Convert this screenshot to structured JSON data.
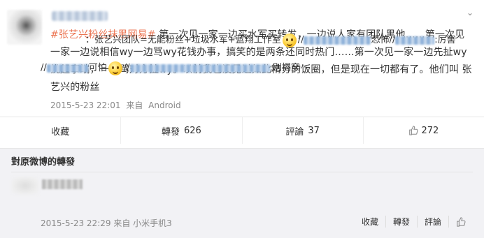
{
  "post": {
    "tag": "#张艺兴粉丝抹黑网易#",
    "text": " 第一次见一家一边买水军买转发，一边说人家有团队黑他……第一次见一家一边说相信wy一边骂wy花钱办事，搞笑的是两条还同时热门……第一次见一家一边先扯wy挑起事端，一边骂对方扯wy。以前我也没见过如此精分的饭圈，但是现在一切都有了。他们叫 张艺兴的粉丝",
    "time": "2015-5-23 22:01",
    "source_prefix": "来自",
    "source": "Android"
  },
  "actions": {
    "collect": "收藏",
    "repost_label": "轉發",
    "repost_count": "626",
    "comment_label": "評論",
    "comment_count": "37",
    "like_count": "272"
  },
  "repost_section": {
    "title": "對原微博的轉發",
    "colon": "：",
    "line1_text": "张艺兴团队=无能粉丝+垃圾水军+蓝翔工作室",
    "sep": "//",
    "k1": "恐怖",
    "k2": ":厉害",
    "line2_a": "可怕",
    "line2_b": ":别揭穿",
    "time": "2015-5-23 22:29",
    "source_prefix": "来自",
    "source": "小米手机3",
    "collect": "收藏",
    "repost": "轉發",
    "comment": "評論"
  },
  "colors": {
    "accent": "#eb7350",
    "text": "#333333",
    "meta": "#888888"
  }
}
